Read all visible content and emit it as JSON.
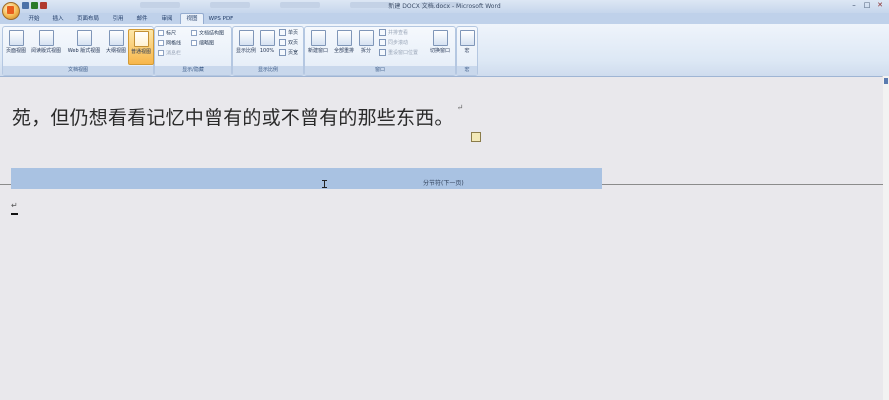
{
  "window": {
    "title": "新建 DOCX 文档.docx - Microsoft Word",
    "minimize": "–",
    "maximize": "□",
    "close": "✕"
  },
  "tabs": [
    {
      "label": "开始"
    },
    {
      "label": "插入"
    },
    {
      "label": "页面布局"
    },
    {
      "label": "引用"
    },
    {
      "label": "邮件"
    },
    {
      "label": "审阅"
    },
    {
      "label": "视图",
      "active": true
    },
    {
      "label": "WPS PDF"
    }
  ],
  "ribbon": {
    "views": {
      "group_label": "文档视图",
      "buttons": [
        "页面视图",
        "阅读版式视图",
        "Web 版式视图",
        "大纲视图",
        "普通视图"
      ],
      "active": "普通视图"
    },
    "show_hide": {
      "group_label": "显示/隐藏",
      "items": [
        "标尺",
        "网格线",
        "消息栏",
        "文档结构图",
        "缩略图"
      ]
    },
    "zoom": {
      "group_label": "显示比例",
      "buttons": [
        "显示比例",
        "100%"
      ],
      "small": [
        "单页",
        "双页",
        "页宽"
      ]
    },
    "window": {
      "group_label": "窗口",
      "buttons": [
        "新建窗口",
        "全部重排",
        "拆分"
      ],
      "small": [
        "并排查看",
        "同步滚动",
        "重设窗口位置"
      ],
      "switch": "切换窗口"
    },
    "macros": {
      "group_label": "宏",
      "button": "宏"
    }
  },
  "document": {
    "text_line": "苑，但仍想看看记忆中曾有的或不曾有的那些东西。",
    "paragraph_mark": "↵",
    "section_break": "分节符(下一页)"
  }
}
